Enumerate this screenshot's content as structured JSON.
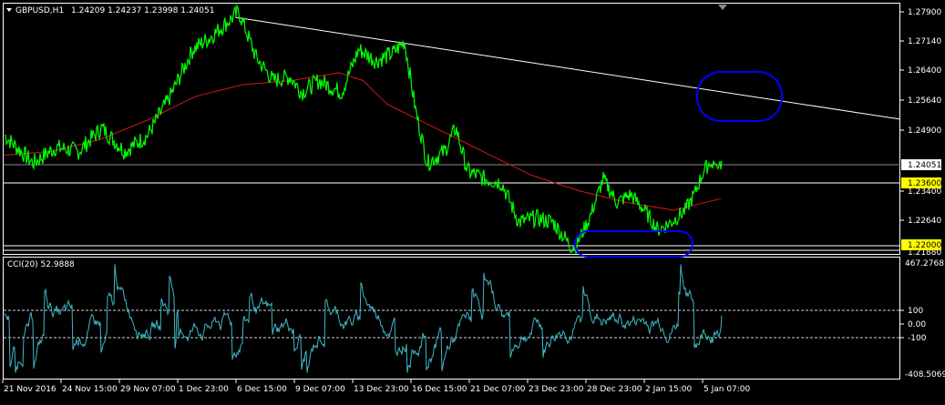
{
  "header": {
    "symbol": "GBPUSD,H1",
    "ohlc": "1.24209 1.24237 1.23998 1.24051",
    "menu_icon": "triangle-down-icon"
  },
  "colors": {
    "background": "#000000",
    "price_line": "#00ff00",
    "moving_average": "#d11a1a",
    "trendline": "#ffffff",
    "ellipse": "#0000ff",
    "cci_line": "#3fb7c6",
    "level_label_bg": "#ffff00",
    "price_label_bg": "#ffffff"
  },
  "price_axis": {
    "ticks": [
      "1.27900",
      "1.27140",
      "1.26400",
      "1.25640",
      "1.24900",
      "1.23400",
      "1.22640"
    ],
    "current_price_label": "1.24051",
    "level_labels": [
      "1.23600",
      "1.22000"
    ],
    "hidden_label": "1.21880"
  },
  "cci_panel": {
    "title": "CCI(20) 52.9888",
    "ticks": [
      "467.2768",
      "100",
      "0.00",
      "-100",
      "-408.5069"
    ]
  },
  "time_axis": {
    "labels": [
      "21 Nov 2016",
      "24 Nov 15:00",
      "29 Nov 07:00",
      "1 Dec 23:00",
      "6 Dec 15:00",
      "9 Dec 07:00",
      "13 Dec 23:00",
      "16 Dec 15:00",
      "21 Dec 07:00",
      "23 Dec 23:00",
      "28 Dec 23:00",
      "2 Jan 15:00",
      "5 Jan 07:00"
    ]
  },
  "chart_data": {
    "type": "line",
    "price_ylim": [
      1.2188,
      1.2805
    ],
    "cci_ylim": [
      -408.5069,
      467.2768
    ],
    "horizontal_levels": [
      1.24051,
      1.236,
      1.22,
      1.2188
    ],
    "trendline": {
      "from": [
        0,
        1.2795
      ],
      "to": [
        1,
        1.251
      ]
    },
    "price_anchors": [
      [
        0,
        1.248
      ],
      [
        0.05,
        1.241
      ],
      [
        0.09,
        1.245
      ],
      [
        0.13,
        1.244
      ],
      [
        0.17,
        1.25
      ],
      [
        0.21,
        1.244
      ],
      [
        0.25,
        1.248
      ],
      [
        0.29,
        1.258
      ],
      [
        0.33,
        1.27
      ],
      [
        0.36,
        1.273
      ],
      [
        0.41,
        1.2795
      ],
      [
        0.44,
        1.268
      ],
      [
        0.47,
        1.262
      ],
      [
        0.5,
        1.263
      ],
      [
        0.52,
        1.259
      ],
      [
        0.55,
        1.262
      ],
      [
        0.59,
        1.259
      ],
      [
        0.62,
        1.27
      ],
      [
        0.65,
        1.267
      ],
      [
        0.68,
        1.269
      ],
      [
        0.7,
        1.272
      ],
      [
        0.72,
        1.254
      ],
      [
        0.74,
        1.241
      ],
      [
        0.77,
        1.244
      ],
      [
        0.79,
        1.25
      ],
      [
        0.81,
        1.239
      ],
      [
        0.84,
        1.237
      ],
      [
        0.87,
        1.236
      ],
      [
        0.9,
        1.226
      ],
      [
        0.93,
        1.227
      ],
      [
        0.96,
        1.226
      ],
      [
        0.99,
        1.22
      ]
    ],
    "price_anchors_b": [
      [
        0,
        1.22
      ],
      [
        0.06,
        1.227
      ],
      [
        0.12,
        1.237
      ],
      [
        0.18,
        1.231
      ],
      [
        0.24,
        1.233
      ],
      [
        0.3,
        1.229
      ],
      [
        0.36,
        1.224
      ],
      [
        0.42,
        1.226
      ],
      [
        0.48,
        1.229
      ],
      [
        0.52,
        1.233
      ],
      [
        0.56,
        1.239
      ],
      [
        0.6,
        1.242
      ],
      [
        0.64,
        1.241
      ]
    ],
    "ma_anchors": [
      [
        0,
        1.243
      ],
      [
        0.1,
        1.244
      ],
      [
        0.2,
        1.247
      ],
      [
        0.3,
        1.252
      ],
      [
        0.4,
        1.258
      ],
      [
        0.5,
        1.261
      ],
      [
        0.6,
        1.262
      ],
      [
        0.7,
        1.264
      ],
      [
        0.75,
        1.262
      ],
      [
        0.8,
        1.256
      ],
      [
        0.9,
        1.25
      ],
      [
        1.0,
        1.244
      ],
      [
        1.1,
        1.238
      ],
      [
        1.2,
        1.234
      ],
      [
        1.3,
        1.231
      ],
      [
        1.4,
        1.229
      ],
      [
        1.5,
        1.232
      ]
    ],
    "cci_current": 52.9888,
    "cci_levels": [
      100,
      0,
      -100
    ]
  }
}
